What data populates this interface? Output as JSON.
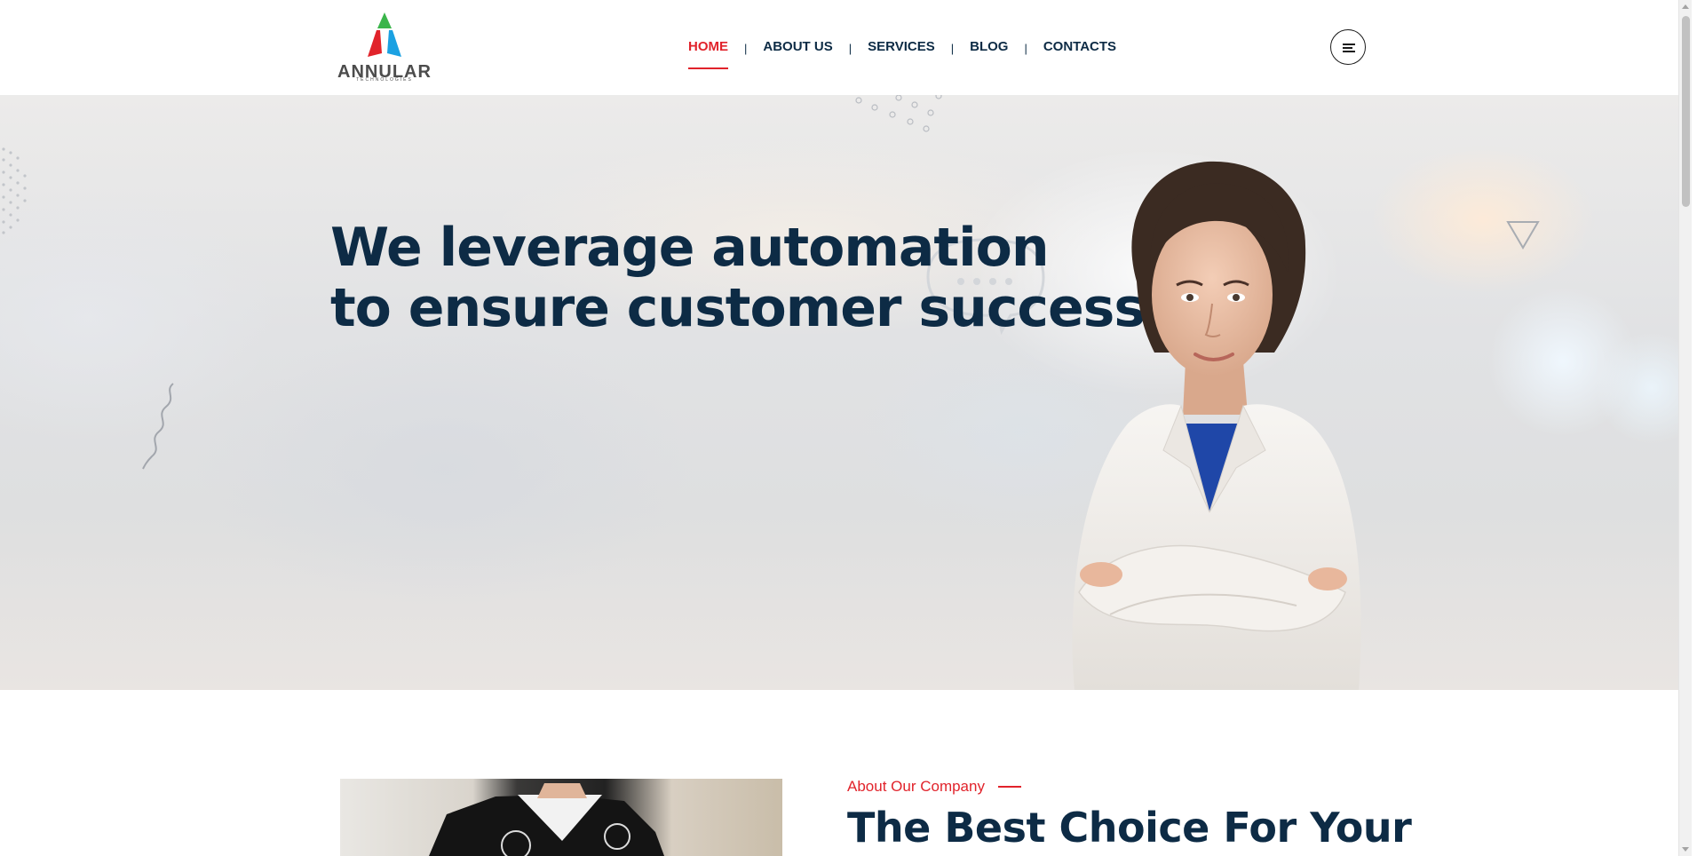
{
  "brand": {
    "name": "ANNULAR",
    "tagline": "TECHNOLOGIES",
    "colors": {
      "green": "#3ab54a",
      "red": "#e1232b",
      "blue": "#1ba1e2",
      "text": "#4c4c4c"
    }
  },
  "nav": {
    "items": [
      {
        "label": "HOME",
        "active": true
      },
      {
        "label": "ABOUT US",
        "active": false
      },
      {
        "label": "SERVICES",
        "active": false
      },
      {
        "label": "BLOG",
        "active": false
      },
      {
        "label": "CONTACTS",
        "active": false
      }
    ],
    "separator": "|",
    "menu_icon": "hamburger-menu-icon"
  },
  "hero": {
    "title_line1": "We leverage automation",
    "title_line2": "to ensure customer success"
  },
  "about": {
    "label": "About Our Company",
    "title": "The Best Choice For Your"
  },
  "theme": {
    "primary": "#0d2b45",
    "accent": "#e1232b"
  }
}
